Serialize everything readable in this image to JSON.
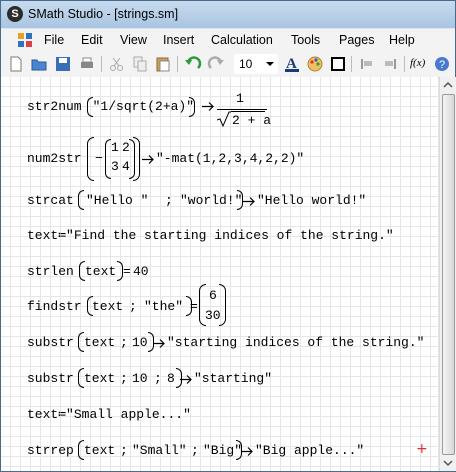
{
  "window": {
    "title": "SMath Studio - [strings.sm]",
    "app_icon_letter": "S"
  },
  "menu": [
    "File",
    "Edit",
    "View",
    "Insert",
    "Calculation",
    "Tools",
    "Pages",
    "Help"
  ],
  "toolbar": {
    "font_size": "10",
    "fx_label": "f(x)"
  },
  "worksheet": {
    "l1_fn": "str2num",
    "l1_arg": "\"1/sqrt(2+a)\"",
    "l1_num": "1",
    "l1_den": "2 + a",
    "l2_fn": "num2str",
    "l2_minus": "−",
    "l2_m11": "1",
    "l2_m12": "2",
    "l2_m21": "3",
    "l2_m22": "4",
    "l2_result": "\"-mat(1,2,3,4,2,2)\"",
    "l3_fn": "strcat",
    "l3_a1": "\"Hello \"",
    "l3_sep": ";",
    "l3_a2": "\"world!\"",
    "l3_result": "\"Hello world!\"",
    "l4_var": "text",
    "l4_assign": "≔",
    "l4_value": "\"Find the starting indices of the string.\"",
    "l5_fn": "strlen",
    "l5_arg": "text",
    "l5_eq": "=",
    "l5_result": "40",
    "l6_fn": "findstr",
    "l6_a1": "text",
    "l6_sep": ";",
    "l6_a2": "\"the\"",
    "l6_eq": "=",
    "l6_r1": "6",
    "l6_r2": "30",
    "l7_fn": "substr",
    "l7_a1": "text",
    "l7_sep": ";",
    "l7_a2": "10",
    "l7_result": "\"starting indices of the string.\"",
    "l8_fn": "substr",
    "l8_a1": "text",
    "l8_sep1": ";",
    "l8_a2": "10",
    "l8_sep2": ";",
    "l8_a3": "8",
    "l8_result": "\"starting\"",
    "l9_var": "text",
    "l9_assign": "≔",
    "l9_value": "\"Small apple...\"",
    "l10_fn": "strrep",
    "l10_a1": "text",
    "l10_sep1": ";",
    "l10_a2": "\"Small\"",
    "l10_sep2": ";",
    "l10_a3": "\"Big\"",
    "l10_result": "\"Big apple...\"",
    "cursor": "+"
  }
}
